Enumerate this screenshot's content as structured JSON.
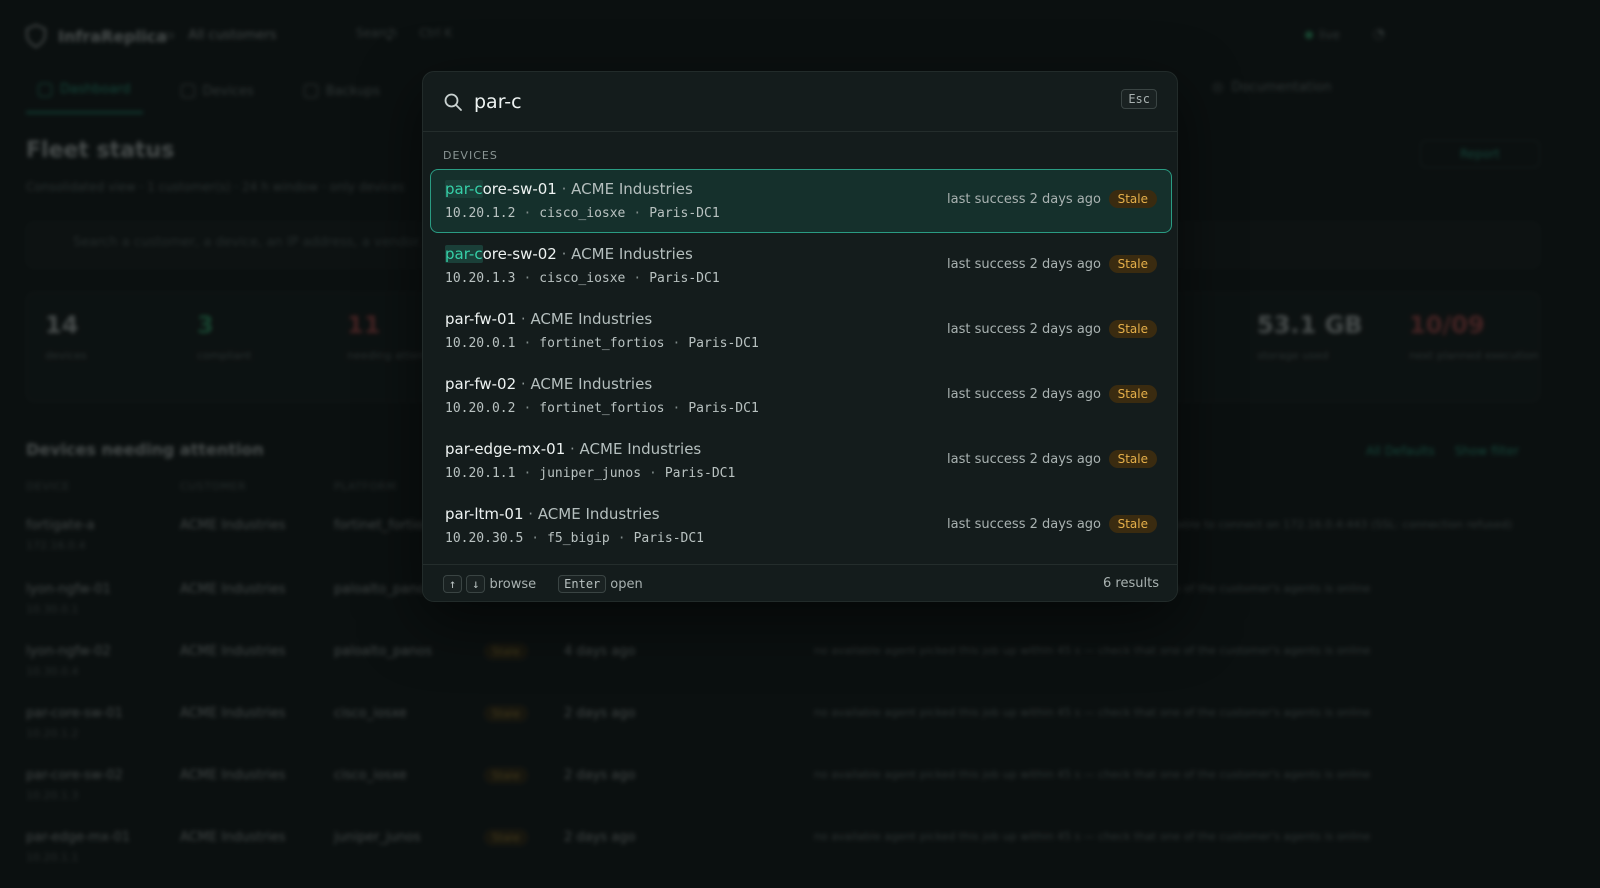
{
  "background": {
    "brand": "InfraReplica",
    "customer_select": "All customers",
    "top_search": "Search",
    "top_search_shortcut": "Ctrl K",
    "status_label": "live",
    "nav": [
      {
        "label": "Dashboard",
        "active": true
      },
      {
        "label": "Devices"
      },
      {
        "label": "Backups"
      }
    ],
    "nav_doc": "Documentation",
    "title": "Fleet status",
    "subtitle": "Consolidated view · 1 customer(s) · 24 h window · only devices",
    "report_button": "Report",
    "search_placeholder": "Search a customer, a device, an IP address, a vendor...",
    "stats": [
      {
        "value": "14",
        "label": "devices",
        "color": "#e6eceb"
      },
      {
        "value": "3",
        "label": "compliant",
        "color": "#3ccf87"
      },
      {
        "value": "11",
        "label": "needing attention",
        "color": "#e05a5a"
      },
      {
        "value": "53.1 GB",
        "label": "storage used",
        "color": "#e6eceb"
      },
      {
        "value": "10/09",
        "label": "next planned execution",
        "color": "#e05a5a"
      }
    ],
    "attention_title": "Devices needing attention",
    "attention_links": [
      "All Defaults",
      "Show filter"
    ],
    "table_headers": [
      "DEVICE",
      "CUSTOMER",
      "PLATFORM"
    ],
    "rows": [
      {
        "device": "fortigate-a",
        "ip": "172.16.0.4",
        "customer": "ACME Industries",
        "platform": "fortinet_fortios",
        "badge": "",
        "age": "",
        "msg": "Unable to connect on 172.16.0.4:443 (SSL: connection refused)"
      },
      {
        "device": "lyon-ngfw-01",
        "ip": "10.30.0.1",
        "customer": "ACME Industries",
        "platform": "paloalto_panos",
        "badge": "Stale",
        "age": "2 days ago",
        "msg": "no available agent picked this job up within 45 s — check that one of the customer's agents is online"
      },
      {
        "device": "lyon-ngfw-02",
        "ip": "10.30.0.4",
        "customer": "ACME Industries",
        "platform": "paloalto_panos",
        "badge": "Stale",
        "age": "4 days ago",
        "msg": "no available agent picked this job up within 45 s — check that one of the customer's agents is online"
      },
      {
        "device": "par-core-sw-01",
        "ip": "10.20.1.2",
        "customer": "ACME Industries",
        "platform": "cisco_iosxe",
        "badge": "Stale",
        "age": "2 days ago",
        "msg": "no available agent picked this job up within 45 s — check that one of the customer's agents is online"
      },
      {
        "device": "par-core-sw-02",
        "ip": "10.20.1.3",
        "customer": "ACME Industries",
        "platform": "cisco_iosxe",
        "badge": "Stale",
        "age": "2 days ago",
        "msg": "no available agent picked this job up within 45 s — check that one of the customer's agents is online"
      },
      {
        "device": "par-edge-mx-01",
        "ip": "10.20.1.1",
        "customer": "ACME Industries",
        "platform": "juniper_junos",
        "badge": "Stale",
        "age": "2 days ago",
        "msg": "no available agent picked this job up within 45 s — check that one of the customer's agents is online"
      }
    ]
  },
  "palette": {
    "query": "par-c",
    "esc_label": "Esc",
    "section_label": "DEVICES",
    "results": [
      {
        "match": "par-c",
        "rest": "ore-sw-01",
        "customer": "ACME Industries",
        "ip": "10.20.1.2",
        "platform": "cisco_iosxe",
        "site": "Paris-DC1",
        "status": "last success 2 days ago",
        "badge": "Stale",
        "selected": true
      },
      {
        "match": "par-c",
        "rest": "ore-sw-02",
        "customer": "ACME Industries",
        "ip": "10.20.1.3",
        "platform": "cisco_iosxe",
        "site": "Paris-DC1",
        "status": "last success 2 days ago",
        "badge": "Stale"
      },
      {
        "match": "",
        "rest": "par-fw-01",
        "customer": "ACME Industries",
        "ip": "10.20.0.1",
        "platform": "fortinet_fortios",
        "site": "Paris-DC1",
        "status": "last success 2 days ago",
        "badge": "Stale"
      },
      {
        "match": "",
        "rest": "par-fw-02",
        "customer": "ACME Industries",
        "ip": "10.20.0.2",
        "platform": "fortinet_fortios",
        "site": "Paris-DC1",
        "status": "last success 2 days ago",
        "badge": "Stale"
      },
      {
        "match": "",
        "rest": "par-edge-mx-01",
        "customer": "ACME Industries",
        "ip": "10.20.1.1",
        "platform": "juniper_junos",
        "site": "Paris-DC1",
        "status": "last success 2 days ago",
        "badge": "Stale"
      },
      {
        "match": "",
        "rest": "par-ltm-01",
        "customer": "ACME Industries",
        "ip": "10.20.30.5",
        "platform": "f5_bigip",
        "site": "Paris-DC1",
        "status": "last success 2 days ago",
        "badge": "Stale"
      }
    ],
    "footer": {
      "up_key": "↑",
      "down_key": "↓",
      "browse_label": "browse",
      "enter_key": "Enter",
      "open_label": "open",
      "count": "6 results"
    }
  }
}
